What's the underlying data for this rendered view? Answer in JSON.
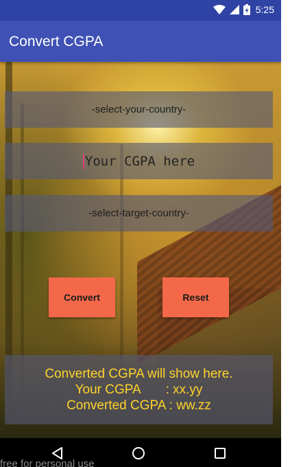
{
  "status_bar": {
    "time": "5:25",
    "icons": [
      "wifi-icon",
      "signal-icon",
      "battery-charging-icon"
    ]
  },
  "app_bar": {
    "title": "Convert CGPA"
  },
  "form": {
    "source_country": "-select-your-country-",
    "cgpa_placeholder": "Your CGPA here",
    "target_country": "-select-target-country-"
  },
  "buttons": {
    "convert": "Convert",
    "reset": "Reset"
  },
  "result": {
    "line1": "Converted CGPA will show here.",
    "line2": "Your CGPA       : xx.yy",
    "line3": "Converted CGPA : ww.zz"
  },
  "nav_bar": {
    "icons": [
      "back-icon",
      "home-icon",
      "recents-icon"
    ]
  },
  "watermark": "free for personal use",
  "colors": {
    "status_bar": "#2f43a5",
    "app_bar": "#3f51b5",
    "button": "#f4684a",
    "result_text": "#ffd32a",
    "field_bg": "#555876"
  }
}
